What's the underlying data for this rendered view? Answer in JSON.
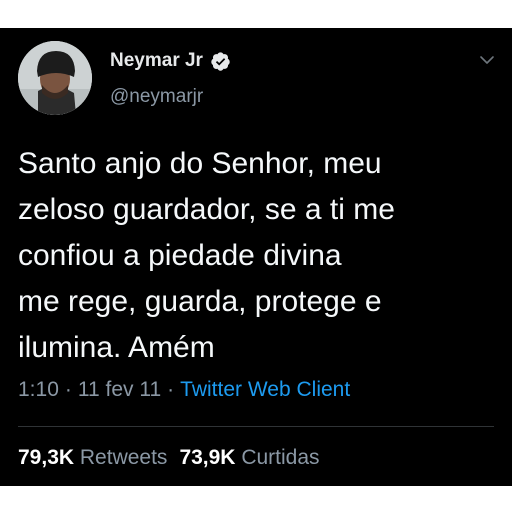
{
  "tweet": {
    "author": {
      "name": "Neymar Jr",
      "handle": "@neymarjr",
      "verified": true
    },
    "text": "Santo anjo do Senhor, meu\nzeloso guardador, se a ti me\nconfiou a piedade divina\nme rege, guarda, protege e\nilumina. Amém",
    "time": "1:10",
    "date": "11 fev 11",
    "separator": "·",
    "client": "Twitter Web Client",
    "stats": {
      "retweets_count": "79,3K",
      "retweets_label": "Retweets",
      "likes_count": "73,9K",
      "likes_label": "Curtidas"
    }
  },
  "colors": {
    "background": "#000000",
    "text": "#f5f8fa",
    "muted": "#8b98a5",
    "accent": "#1d9bf0",
    "divider": "#2f3336"
  },
  "icons": [
    "verified-badge-icon",
    "chevron-down-icon"
  ]
}
